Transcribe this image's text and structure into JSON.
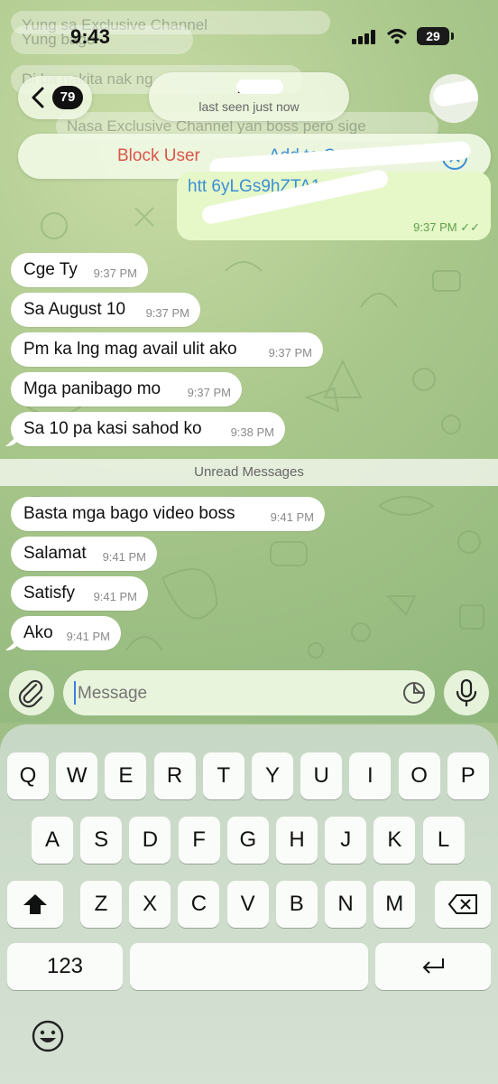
{
  "status_bar": {
    "time": "9:43",
    "battery": "29"
  },
  "ghost_messages": [
    "Yung sa Exclusive Channel",
    "Yung bago",
    "Di ba nakita nak ng",
    "Nasa Exclusive Channel yan boss pero sige"
  ],
  "header": {
    "unread_count": "79",
    "name": "B...",
    "last_seen": "last seen just now"
  },
  "action_bar": {
    "block_label": "Block User",
    "add_label": "Add to Contacts"
  },
  "outgoing": {
    "link_text": "htt                        6yLGs9hZTA1",
    "time": "9:37 PM"
  },
  "messages_before": [
    {
      "text": "Cge Ty",
      "time": "9:37 PM"
    },
    {
      "text": "Sa August 10",
      "time": "9:37 PM"
    },
    {
      "text": "Pm ka lng mag avail ulit ako",
      "time": "9:37 PM"
    },
    {
      "text": "Mga panibago mo",
      "time": "9:37 PM"
    },
    {
      "text": "Sa 10 pa kasi sahod ko",
      "time": "9:38 PM"
    }
  ],
  "unread_label": "Unread Messages",
  "messages_after": [
    {
      "text": "Basta mga bago video boss",
      "time": "9:41 PM"
    },
    {
      "text": "Salamat",
      "time": "9:41 PM"
    },
    {
      "text": "Satisfy",
      "time": "9:41 PM"
    },
    {
      "text": "Ako",
      "time": "9:41 PM"
    }
  ],
  "composer": {
    "placeholder": "Message"
  },
  "keyboard": {
    "row1": [
      "Q",
      "W",
      "E",
      "R",
      "T",
      "Y",
      "U",
      "I",
      "O",
      "P"
    ],
    "row2": [
      "A",
      "S",
      "D",
      "F",
      "G",
      "H",
      "J",
      "K",
      "L"
    ],
    "row3": [
      "Z",
      "X",
      "C",
      "V",
      "B",
      "N",
      "M"
    ],
    "numbers_label": "123"
  },
  "colors": {
    "accent": "#3b8fd6",
    "danger": "#d9564a",
    "bubble_out": "#e6f7c8"
  }
}
